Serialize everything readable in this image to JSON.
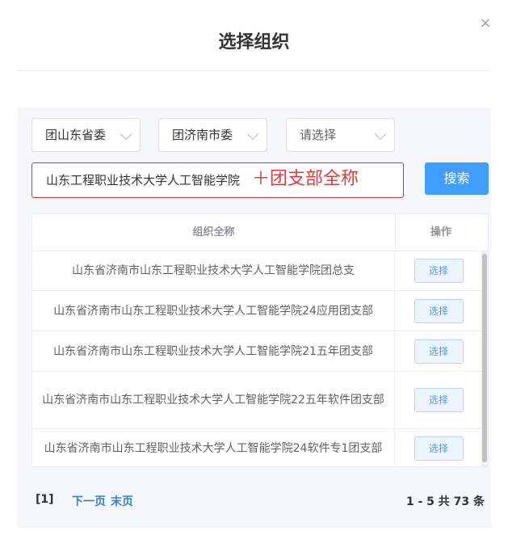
{
  "dialog": {
    "title": "选择组织",
    "close_symbol": "×"
  },
  "filters": {
    "province": "团山东省委",
    "city": "团济南市委",
    "third_placeholder": "请选择"
  },
  "search": {
    "typed_text": "山东工程职业技术大学人工智能学院",
    "annotation": "＋团支部全称",
    "button_label": "搜索"
  },
  "table": {
    "headers": [
      "组织全称",
      "操作"
    ],
    "rows": [
      {
        "name": "山东省济南市山东工程职业技术大学人工智能学院团总支",
        "action": "选择"
      },
      {
        "name": "山东省济南市山东工程职业技术大学人工智能学院24应用团支部",
        "action": "选择"
      },
      {
        "name": "山东省济南市山东工程职业技术大学人工智能学院21五年团支部",
        "action": "选择"
      },
      {
        "name": "山东省济南市山东工程职业技术大学人工智能学院22五年软件团支部",
        "action": "选择"
      },
      {
        "name": "山东省济南市山东工程职业技术大学人工智能学院24软件专1团支部",
        "action": "选择"
      }
    ]
  },
  "pagination": {
    "current": "[1]",
    "next_label": "下一页",
    "last_label": "末页",
    "summary": "1 - 5  共 73 条"
  },
  "colors": {
    "primary": "#409eff",
    "annotation_red": "#e23b3b",
    "link_blue": "#3b7fc4"
  },
  "icons": {
    "close": "close-icon",
    "dropdown": "chevron-down-icon"
  }
}
